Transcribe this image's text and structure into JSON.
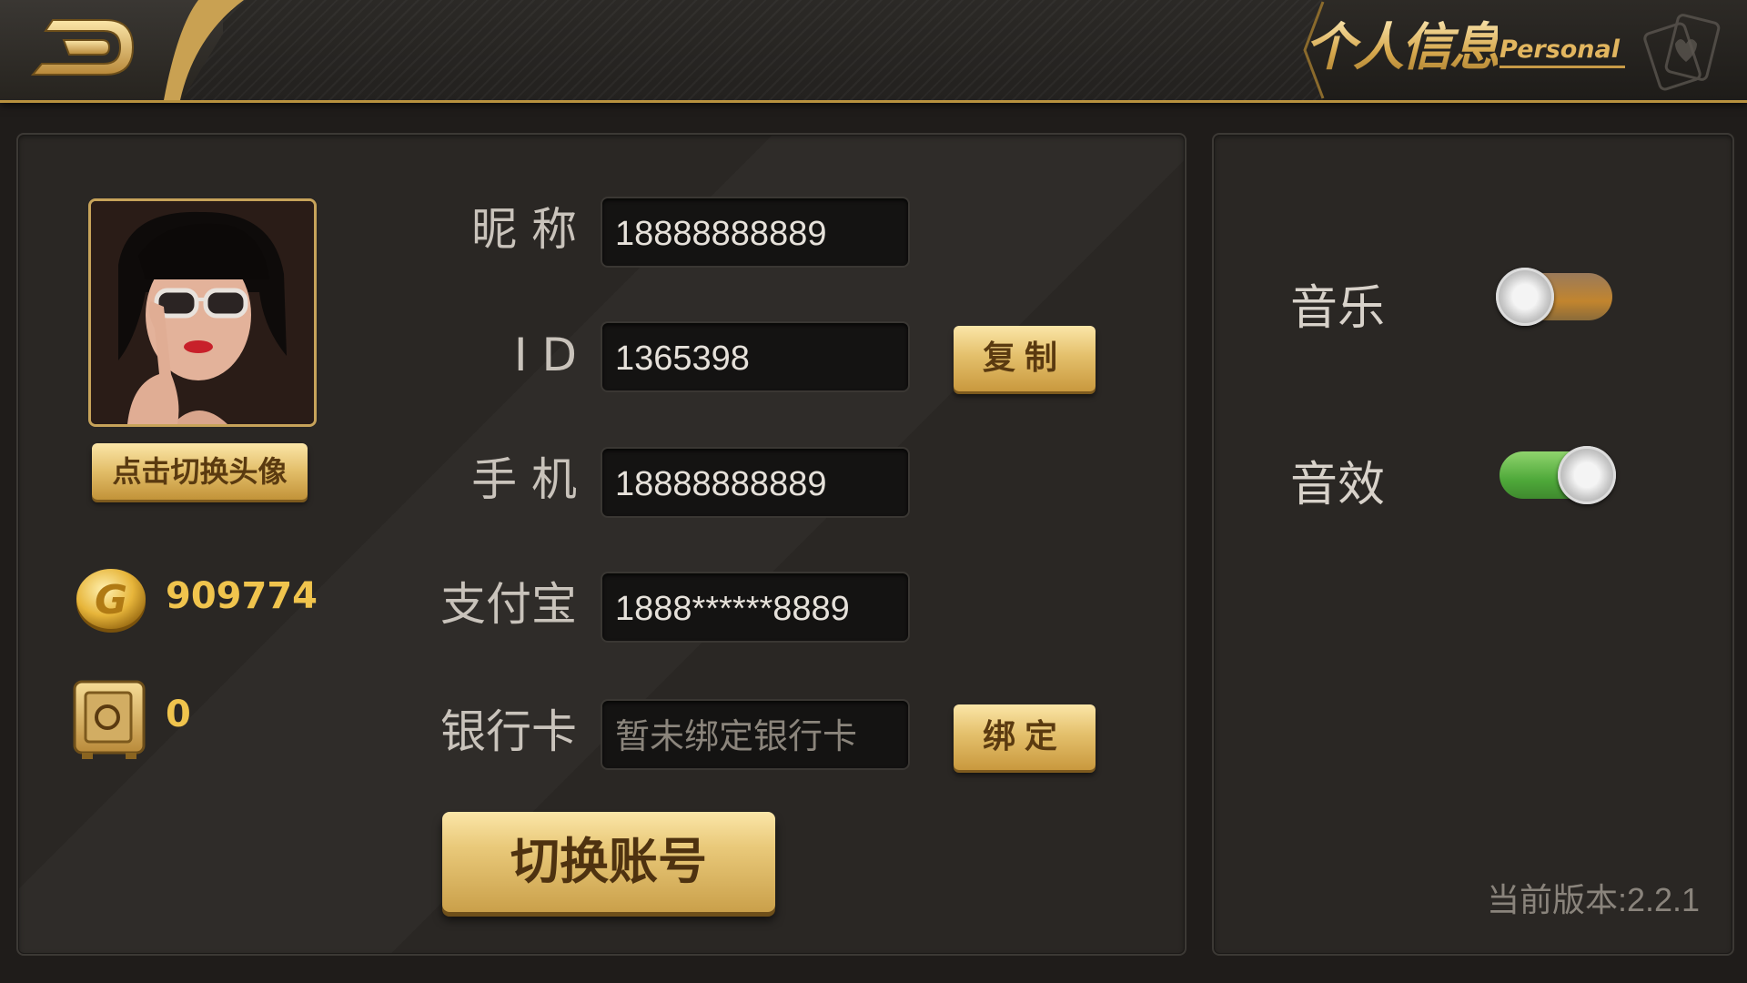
{
  "header": {
    "title": "个人信息",
    "subtitle": "Personal"
  },
  "profile": {
    "change_avatar_label": "点击切换头像",
    "gold": "909774",
    "safe_box": "0"
  },
  "form": {
    "nickname_label": "昵 称",
    "nickname_value": "18888888889",
    "id_label": "I D",
    "id_value": "1365398",
    "copy_label": "复制",
    "phone_label": "手 机",
    "phone_value": "18888888889",
    "alipay_label": "支付宝",
    "alipay_value": "1888******8889",
    "bank_label": "银行卡",
    "bank_placeholder": "暂未绑定银行卡",
    "bind_label": "绑定",
    "switch_account_label": "切换账号"
  },
  "settings": {
    "music_label": "音乐",
    "music_on": false,
    "sfx_label": "音效",
    "sfx_on": true,
    "version": "当前版本:2.2.1"
  },
  "colors": {
    "accent_gold": "#e2b65f",
    "toggle_on": "#4fa93a",
    "toggle_off": "#c2852e"
  },
  "icons": [
    "back-arrow-icon",
    "playing-cards-icon",
    "gold-coin-icon",
    "safe-box-icon"
  ]
}
